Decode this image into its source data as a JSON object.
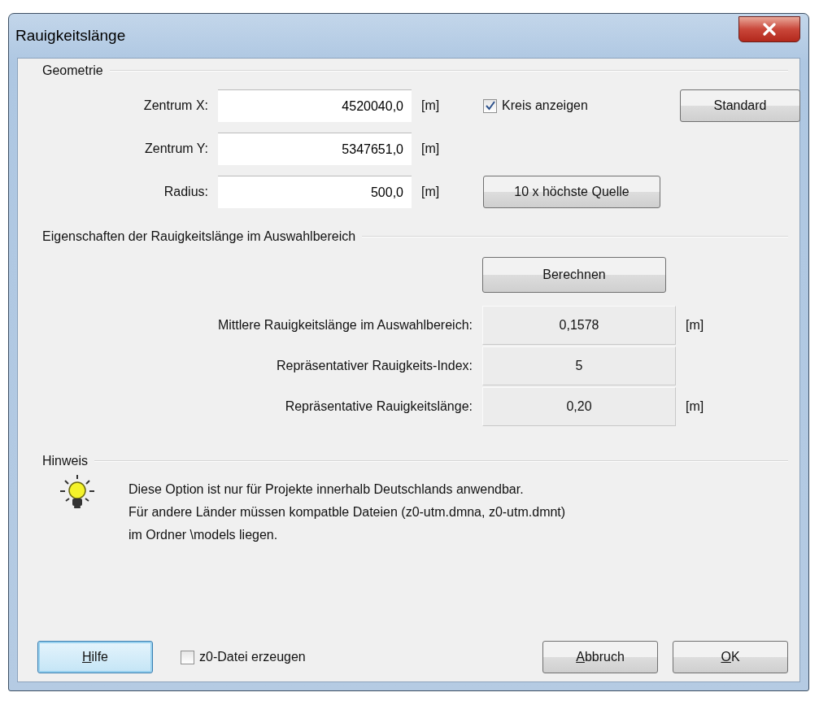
{
  "window": {
    "title": "Rauigkeitslänge"
  },
  "geometry": {
    "title": "Geometrie",
    "fields": [
      {
        "label": "Zentrum X:",
        "value": "4520040,0",
        "unit": "[m]"
      },
      {
        "label": "Zentrum Y:",
        "value": "5347651,0",
        "unit": "[m]"
      },
      {
        "label": "Radius:",
        "value": "500,0",
        "unit": "[m]"
      }
    ],
    "show_circle": {
      "label": "Kreis anzeigen",
      "checked": true
    },
    "default_button": "Standard",
    "source_button": "10 x höchste Quelle"
  },
  "properties": {
    "title": "Eigenschaften der Rauigkeitslänge im Auswahlbereich",
    "compute_button": "Berechnen",
    "results": [
      {
        "label": "Mittlere Rauigkeitslänge im Auswahlbereich:",
        "value": "0,1578",
        "unit": "[m]"
      },
      {
        "label": "Repräsentativer Rauigkeits-Index:",
        "value": "5"
      },
      {
        "label": "Repräsentative Rauigkeitslänge:",
        "value": "0,20",
        "unit": "[m]"
      }
    ]
  },
  "note": {
    "title": "Hinweis",
    "lines": [
      "Diese Option ist nur für Projekte innerhalb Deutschlands anwendbar.",
      "Für andere Länder müssen kompatble Dateien (z0-utm.dmna, z0-utm.dmnt)",
      "im Ordner \\models liegen."
    ]
  },
  "footer": {
    "help_button": {
      "label": "Hilfe",
      "mnemonic": true,
      "focused": true
    },
    "create_file": {
      "label": "z0-Datei erzeugen",
      "checked": false
    },
    "buttons": [
      {
        "label": "Abbruch",
        "mnemonic": true
      },
      {
        "label": "OK",
        "mnemonic": true
      }
    ]
  }
}
